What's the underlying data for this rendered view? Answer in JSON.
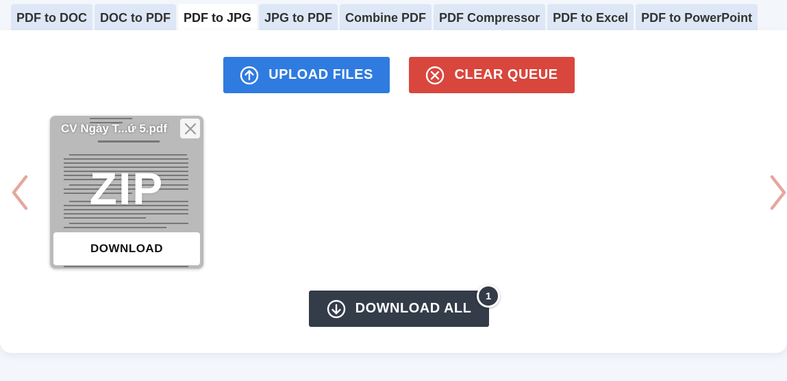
{
  "tabs": [
    {
      "label": "PDF to DOC"
    },
    {
      "label": "DOC to PDF"
    },
    {
      "label": "PDF to JPG"
    },
    {
      "label": "JPG to PDF"
    },
    {
      "label": "Combine PDF"
    },
    {
      "label": "PDF Compressor"
    },
    {
      "label": "PDF to Excel"
    },
    {
      "label": "PDF to PowerPoint"
    }
  ],
  "active_tab": "PDF to JPG",
  "toolbar": {
    "upload_label": "UPLOAD FILES",
    "clear_label": "CLEAR QUEUE"
  },
  "queue": {
    "files": [
      {
        "name": "CV Ngày T...ứ 5.pdf",
        "overlay_label": "ZIP",
        "download_label": "DOWNLOAD"
      }
    ]
  },
  "download_all": {
    "label": "DOWNLOAD ALL",
    "count": "1"
  },
  "icons": {
    "upload": "arrow-up-circle-icon",
    "clear": "x-circle-icon",
    "download_all": "arrow-down-circle-icon",
    "nav_prev": "chevron-left-icon",
    "nav_next": "chevron-right-icon",
    "card_close": "close-icon"
  },
  "colors": {
    "upload_button": "#2f7be0",
    "clear_button": "#d9463d",
    "download_all_button": "#333c48",
    "nav_arrows": "#e5a79e",
    "tab_background": "#dde7f5"
  }
}
